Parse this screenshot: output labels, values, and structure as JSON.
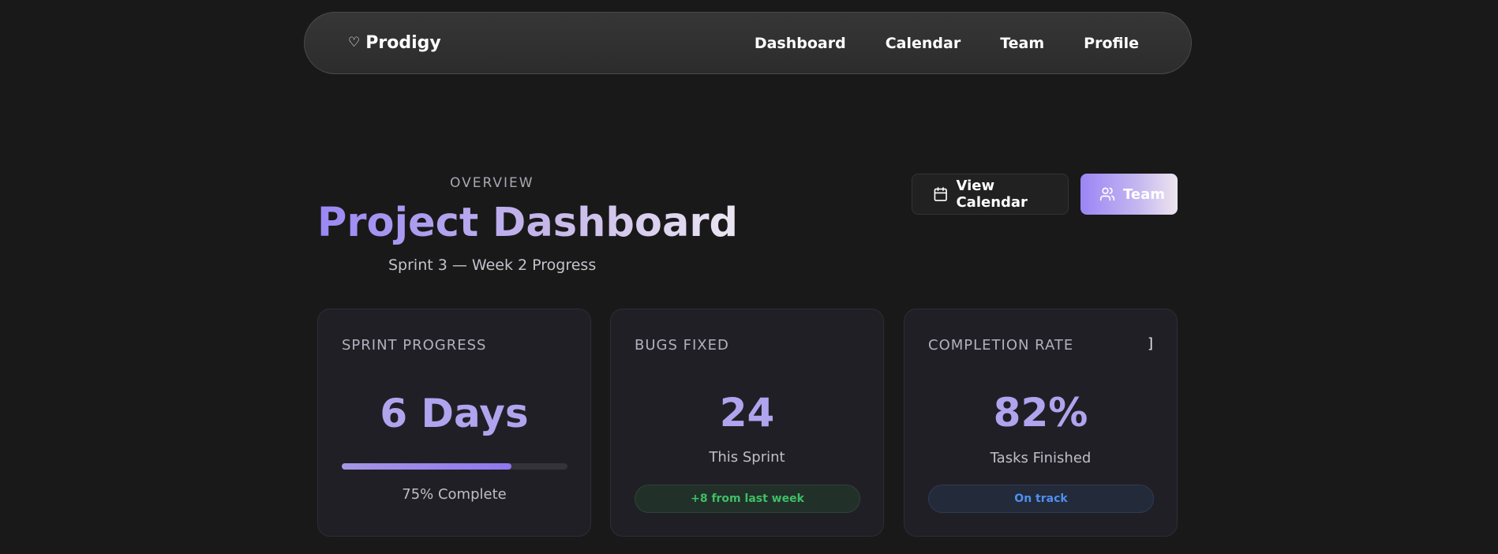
{
  "nav": {
    "brand_icon": "♡",
    "brand_name": "Prodigy",
    "links": [
      "Dashboard",
      "Calendar",
      "Team",
      "Profile"
    ]
  },
  "header": {
    "eyebrow": "OVERVIEW",
    "title": "Project Dashboard",
    "subtitle": "Sprint 3 — Week 2 Progress"
  },
  "actions": {
    "view_calendar": "View Calendar",
    "team": "Team"
  },
  "cards": [
    {
      "label": "SPRINT PROGRESS",
      "value": "6 Days",
      "progress_percent": 75,
      "caption": "75% Complete"
    },
    {
      "label": "BUGS FIXED",
      "value": "24",
      "caption": "This Sprint",
      "badge": "+8 from last week"
    },
    {
      "label": "COMPLETION RATE",
      "corner_glyph": "]",
      "value": "82%",
      "caption": "Tasks Finished",
      "badge": "On track"
    }
  ],
  "colors": {
    "background": "#191919",
    "accent": "#9b85f5",
    "value": "#b1a4ee",
    "success": "#3fbf66",
    "info": "#4f8ff0"
  },
  "icons": {
    "brand": "heart-icon",
    "view_calendar": "calendar-icon",
    "team": "users-icon"
  }
}
